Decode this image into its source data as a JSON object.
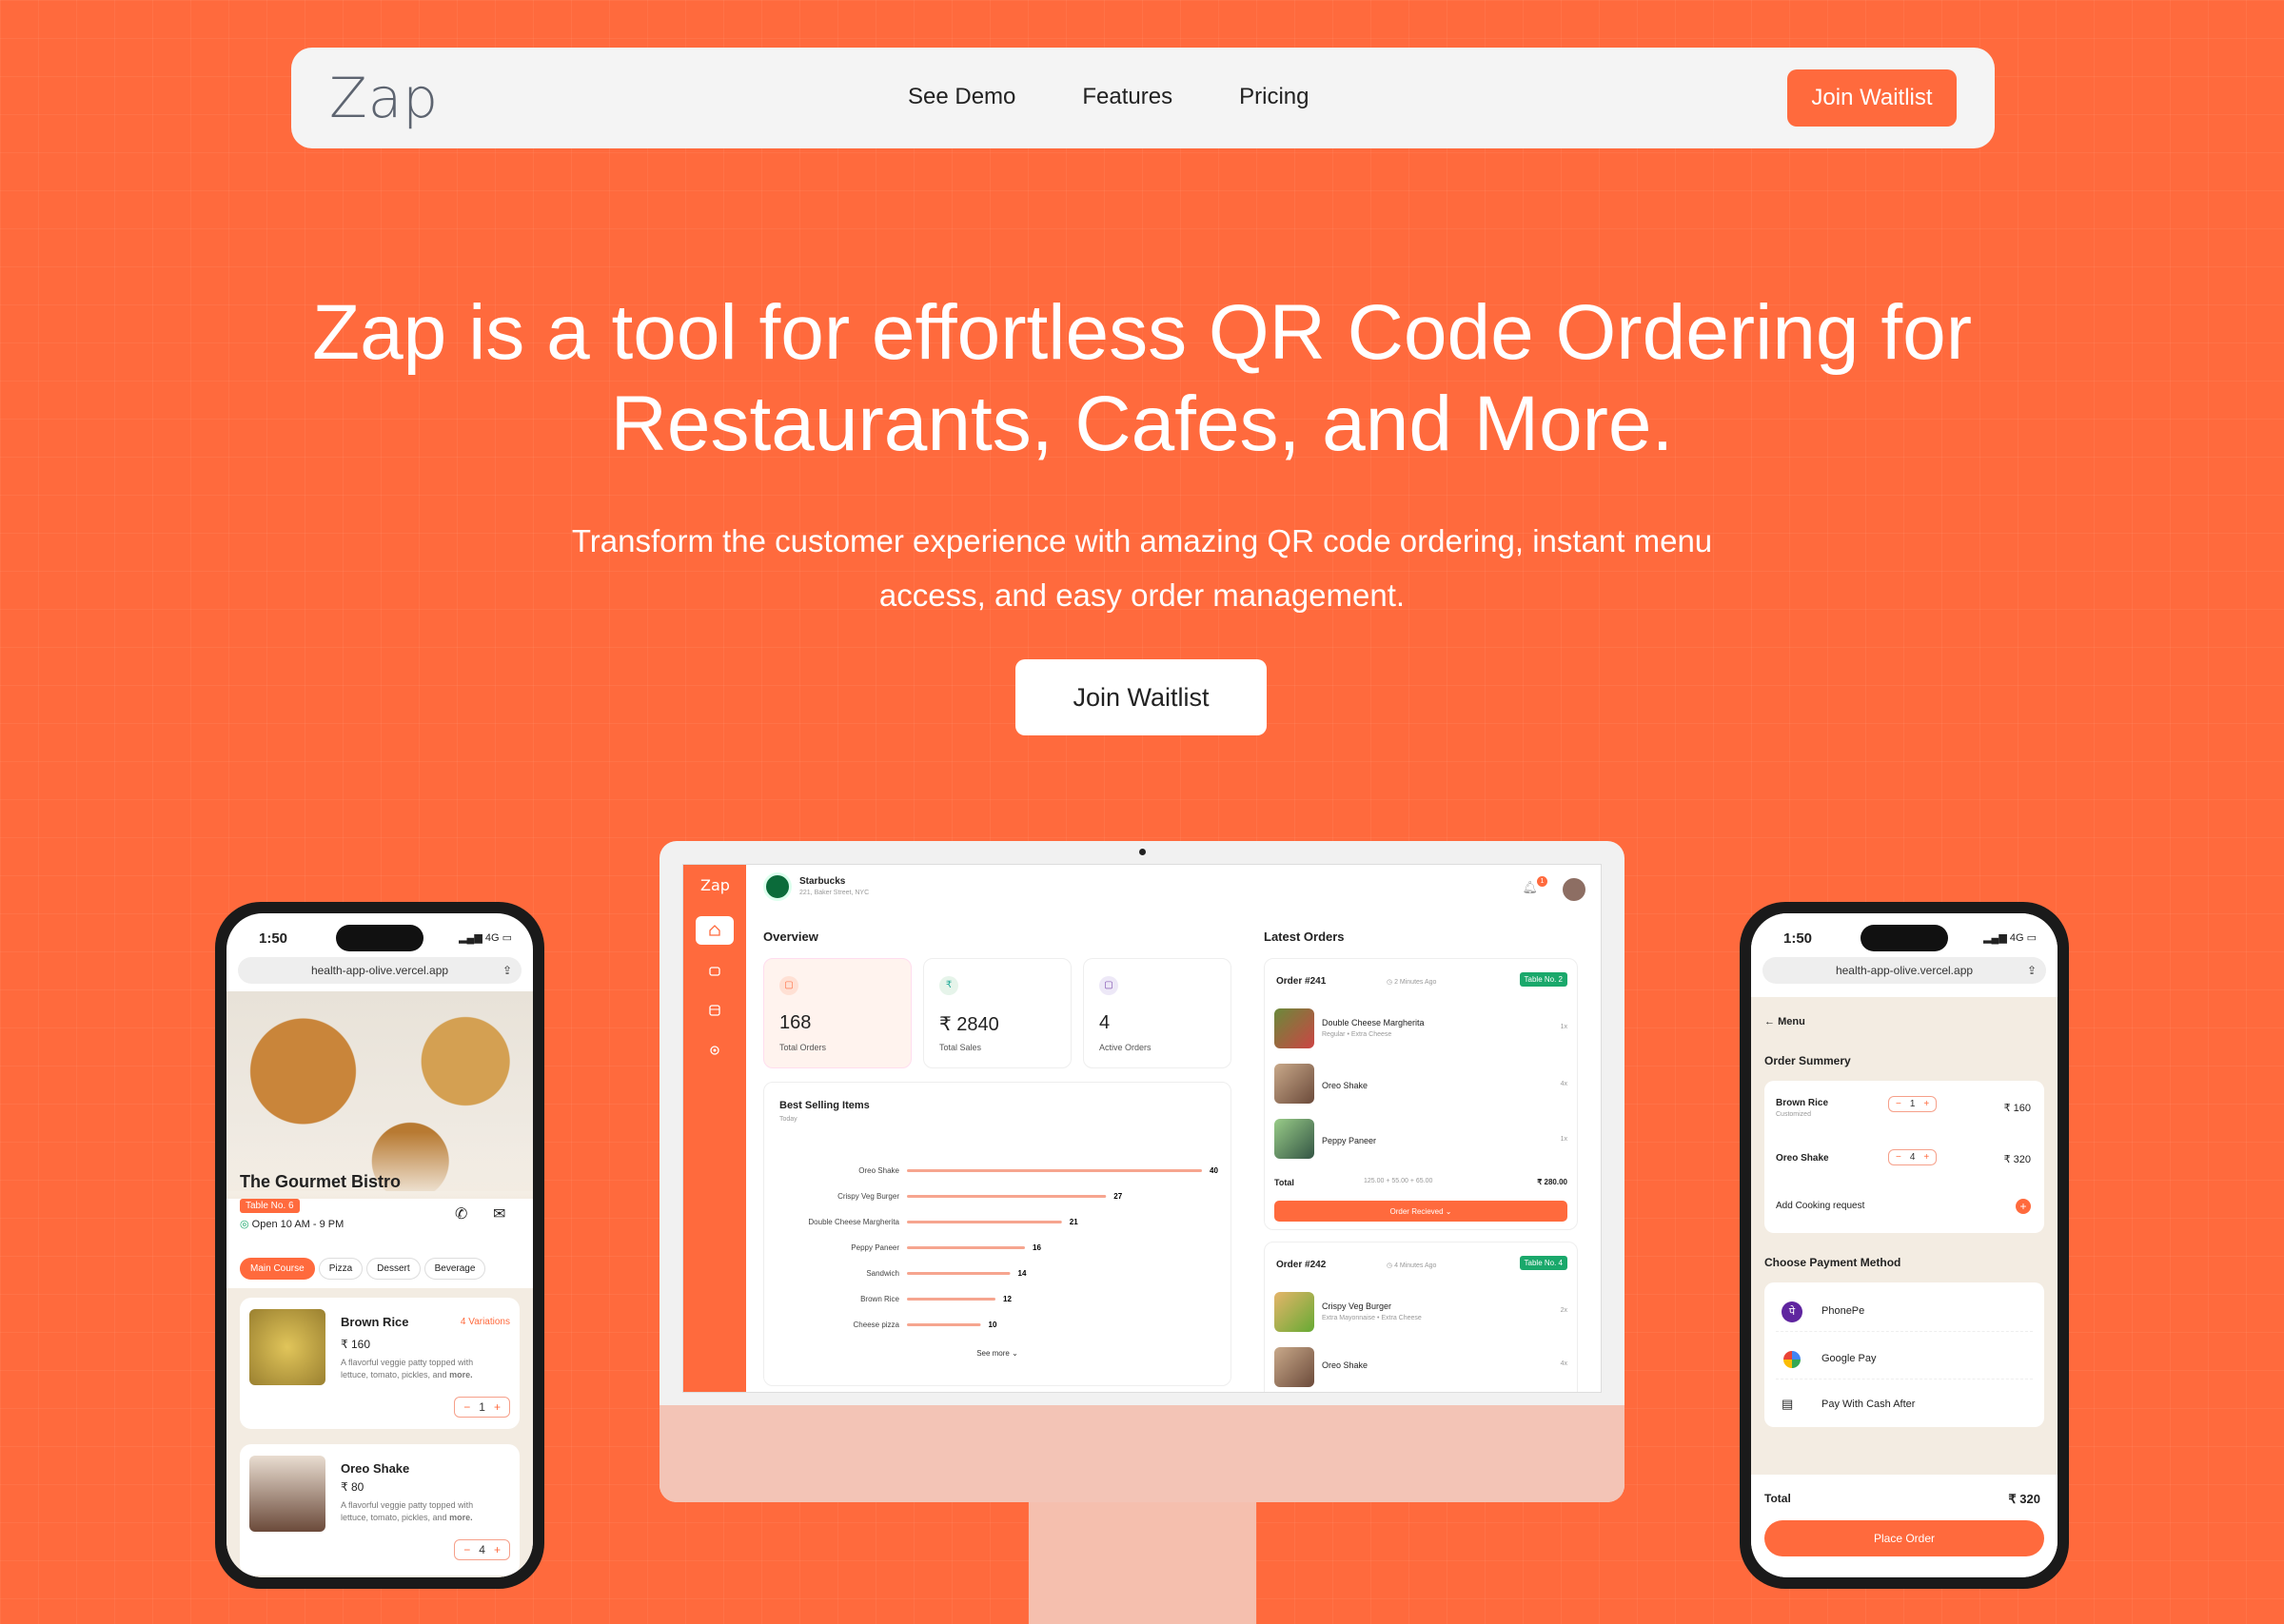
{
  "nav": {
    "logo": "Zap",
    "links": [
      "See Demo",
      "Features",
      "Pricing"
    ],
    "cta": "Join Waitlist"
  },
  "hero": {
    "line1": "Zap is a tool for effortless QR Code Ordering for",
    "line2": "Restaurants, Cafes, and More.",
    "sub1": "Transform the customer experience with amazing QR code ordering, instant menu",
    "sub2": "access, and easy order management.",
    "cta": "Join Waitlist"
  },
  "dashboard": {
    "logo": "Zap",
    "store": "Starbucks",
    "address": "221, Baker Street, NYC",
    "notif": "1",
    "overview": "Overview",
    "stats": [
      {
        "value": "168",
        "label": "Total Orders"
      },
      {
        "value": "₹ 2840",
        "label": "Total Sales"
      },
      {
        "value": "4",
        "label": "Active Orders"
      }
    ],
    "best": {
      "title": "Best Selling Items",
      "sub": "Today",
      "more": "See more"
    },
    "latest": "Latest Orders",
    "orders": [
      {
        "id": "Order #241",
        "time": "2 Minutes Ago",
        "table": "Table No. 2",
        "items": [
          {
            "name": "Double Cheese Margherita",
            "opts": "Regular • Extra Cheese",
            "qty": "1x"
          },
          {
            "name": "Oreo Shake",
            "opts": "",
            "qty": "4x"
          },
          {
            "name": "Peppy Paneer",
            "opts": "",
            "qty": "1x"
          }
        ],
        "total_label": "Total",
        "breakdown": "125.00 + 55.00 + 65.00",
        "total": "₹ 280.00",
        "status": "Order Recieved"
      },
      {
        "id": "Order #242",
        "time": "4 Minutes Ago",
        "table": "Table No. 4",
        "items": [
          {
            "name": "Crispy Veg Burger",
            "opts": "Extra Mayonnaise • Extra Cheese",
            "qty": "2x"
          },
          {
            "name": "Oreo Shake",
            "opts": "",
            "qty": "4x"
          }
        ]
      }
    ]
  },
  "chart_data": {
    "type": "bar",
    "title": "Best Selling Items",
    "categories": [
      "Oreo Shake",
      "Crispy Veg Burger",
      "Double Cheese Margherita",
      "Peppy Paneer",
      "Sandwich",
      "Brown Rice",
      "Cheese pizza"
    ],
    "values": [
      40,
      27,
      21,
      16,
      14,
      12,
      10
    ]
  },
  "left_phone": {
    "time": "1:50",
    "signal": "4G",
    "url": "health-app-olive.vercel.app",
    "name": "The Gourmet Bistro",
    "table": "Table No. 6",
    "hours": "Open  10 AM - 9 PM",
    "tabs": [
      "Main Course",
      "Pizza",
      "Dessert",
      "Beverage"
    ],
    "items": [
      {
        "name": "Brown Rice",
        "price": "₹ 160",
        "var": "4 Variations",
        "desc1": "A flavorful veggie patty topped with",
        "desc2": "lettuce, tomato, pickles, and ",
        "more": "more.",
        "qty": "1"
      },
      {
        "name": "Oreo Shake",
        "price": "₹ 80",
        "var": "",
        "desc1": "A flavorful veggie patty topped with",
        "desc2": "lettuce, tomato, pickles, and ",
        "more": "more.",
        "qty": "4"
      }
    ]
  },
  "right_phone": {
    "time": "1:50",
    "signal": "4G",
    "url": "health-app-olive.vercel.app",
    "back": "Menu",
    "summary": "Order Summery",
    "items": [
      {
        "name": "Brown Rice",
        "opts": "Customized",
        "qty": "1",
        "price": "₹ 160"
      },
      {
        "name": "Oreo Shake",
        "opts": "",
        "qty": "4",
        "price": "₹ 320"
      }
    ],
    "cooking": "Add Cooking request",
    "pay_title": "Choose Payment Method",
    "pay": [
      "PhonePe",
      "Google Pay",
      "Pay With Cash After"
    ],
    "total_label": "Total",
    "total": "₹ 320",
    "cta": "Place Order"
  }
}
